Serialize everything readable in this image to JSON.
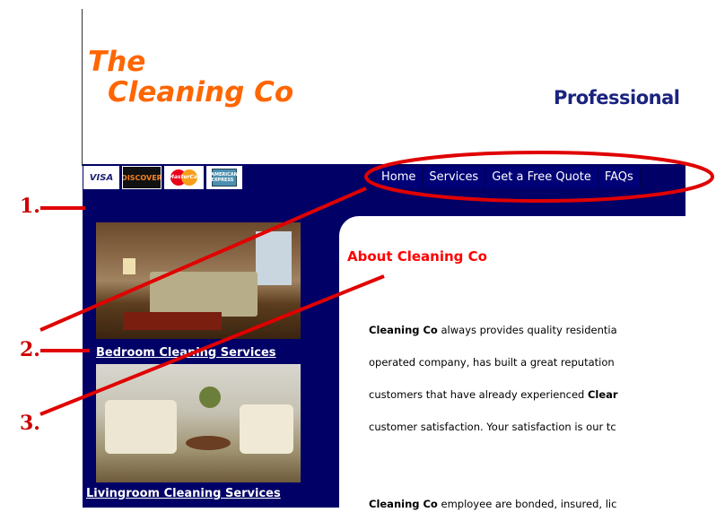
{
  "header": {
    "logo_line1": "The",
    "logo_line2": "Cleaning Co",
    "tagline": "Professional"
  },
  "payment_cards": {
    "visa": "VISA",
    "discover": "DISCOVER",
    "mastercard": "MasterCard",
    "amex": "AMERICAN EXPRESS"
  },
  "nav": {
    "items": [
      "Home",
      "Services",
      "Get a Free Quote",
      "FAQs"
    ]
  },
  "sidebar": {
    "images": [
      {
        "caption": "Bedroom Cleaning Services"
      },
      {
        "caption": "Livingroom Cleaning Services"
      }
    ]
  },
  "main": {
    "heading": "About Cleaning Co",
    "lines": [
      {
        "bold": "Cleaning Co",
        "rest": " always provides quality residentia"
      },
      {
        "bold": "",
        "rest": "operated company, has built a great reputation"
      },
      {
        "pre": "customers that have already experienced ",
        "bold": "Clear"
      },
      {
        "bold": "",
        "rest": "customer satisfaction. Your satisfaction is our tc"
      },
      {
        "bold": "Cleaning Co",
        "rest": " employee are bonded, insured, lic"
      }
    ]
  },
  "annotations": {
    "labels": [
      "1.",
      "2.",
      "3."
    ],
    "color": "#cc0000"
  }
}
